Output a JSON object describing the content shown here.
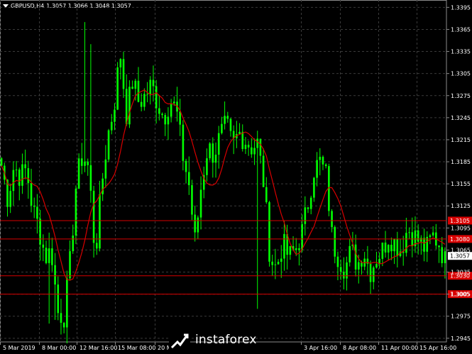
{
  "header": {
    "symbol": "GBPUSD,H4",
    "ohlc": "1.3057 1.3066 1.3048 1.3057"
  },
  "watermark": {
    "brand": "instaforex"
  },
  "colors": {
    "background": "#000000",
    "candle": "#00ff00",
    "ma": "#d80000",
    "level": "#d80000",
    "grid": "#3a3a3a",
    "axis_text": "#ffffff"
  },
  "chart_data": {
    "type": "candlestick",
    "ylim": [
      2.9445,
      1.3405
    ],
    "y_ticks": [
      "1.3395",
      "1.3365",
      "1.3335",
      "1.3305",
      "1.3275",
      "1.3245",
      "1.3215",
      "1.3185",
      "1.3155",
      "1.3125",
      "1.3095",
      "1.3065",
      "1.3035",
      "1.3005",
      "1.2975",
      "1.2945"
    ],
    "x_ticks": [
      "5 Mar 2019",
      "8 Mar 00:00",
      "12 Mar 16:00",
      "15 Mar 08:00",
      "20 Mar",
      "3 Apr 16:00",
      "8 Apr 08:00",
      "11 Apr 00:00",
      "15 Apr 16:00"
    ],
    "levels": [
      {
        "value": 1.3105,
        "label": "1.3105"
      },
      {
        "value": 1.308,
        "label": "1.3080"
      },
      {
        "value": 1.303,
        "label": "1.3030"
      },
      {
        "value": 1.3005,
        "label": "1.3005"
      }
    ],
    "current_price": {
      "value": 1.3057,
      "label": "1.3057"
    },
    "close_path": [
      1.318,
      1.3135,
      1.318,
      1.3165,
      1.3175,
      1.312,
      1.3095,
      1.3055,
      1.3065,
      1.298,
      1.2975,
      1.305,
      1.316,
      1.3195,
      1.3175,
      1.3055,
      1.315,
      1.322,
      1.326,
      1.3335,
      1.325,
      1.3295,
      1.3265,
      1.3275,
      1.329,
      1.3265,
      1.3245,
      1.327,
      1.3255,
      1.3195,
      1.3155,
      1.3075,
      1.3155,
      1.3205,
      1.3195,
      1.322,
      1.3235,
      1.3205,
      1.3225,
      1.3215,
      1.3205,
      1.321,
      1.3155,
      1.3055,
      1.304,
      1.3075,
      1.3055,
      1.3065,
      1.3085,
      1.3125,
      1.3175,
      1.3185,
      1.3165,
      1.3075,
      1.3055,
      1.304,
      1.3065,
      1.3045,
      1.3065,
      1.3035,
      1.3055,
      1.3065,
      1.3085,
      1.3075,
      1.3065,
      1.3095,
      1.3085,
      1.3075,
      1.3065,
      1.3085,
      1.3075,
      1.305
    ]
  }
}
